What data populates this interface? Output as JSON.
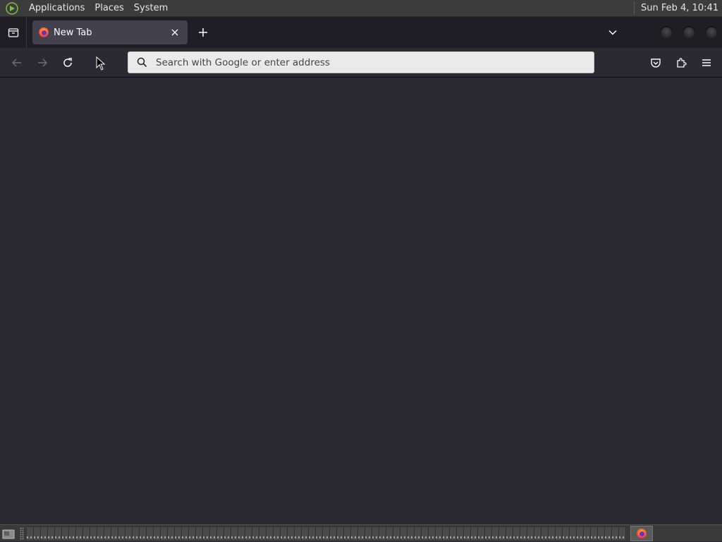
{
  "system_panel": {
    "menus": [
      "Applications",
      "Places",
      "System"
    ],
    "clock": "Sun Feb  4, 10:41"
  },
  "browser": {
    "tabs": [
      {
        "title": "New Tab",
        "active": true
      }
    ],
    "urlbar": {
      "placeholder": "Search with Google or enter address",
      "value": ""
    }
  },
  "colors": {
    "content_bg": "#2b2a33",
    "tabstrip_bg": "#1f1e25",
    "active_tab_bg": "#42414d"
  }
}
